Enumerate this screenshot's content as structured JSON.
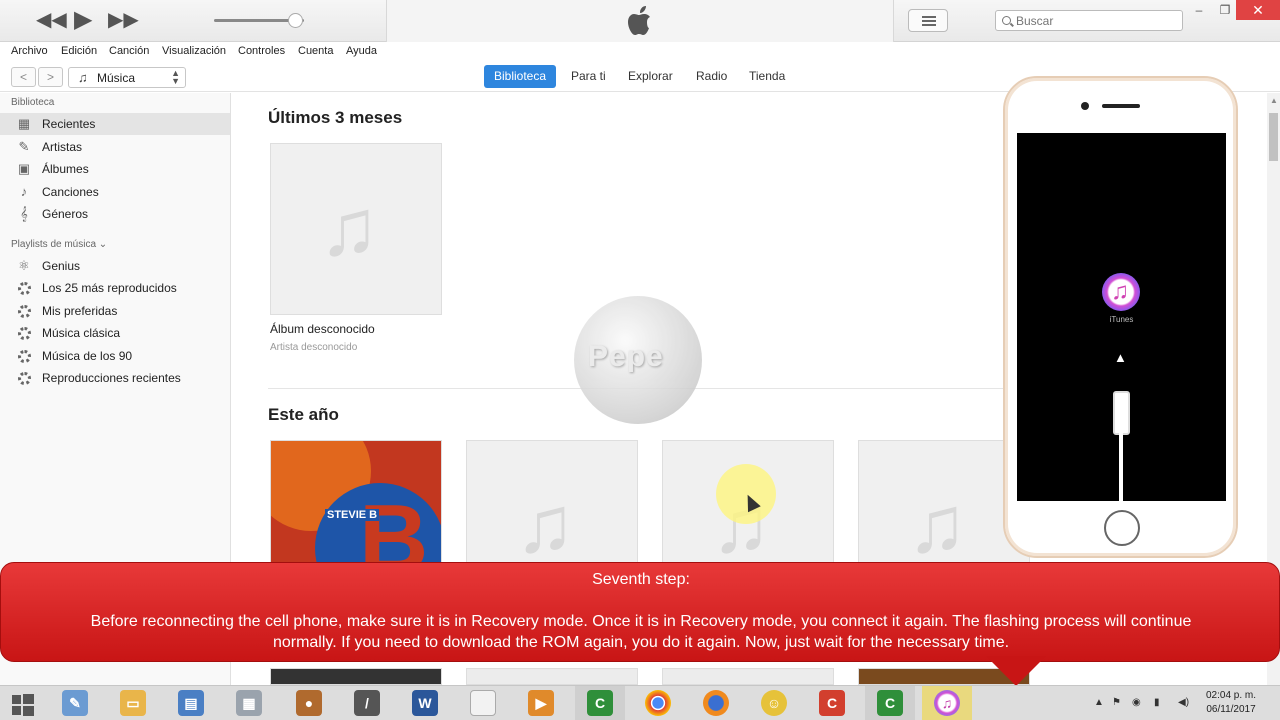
{
  "window": {
    "search_placeholder": "Buscar",
    "minimize": "–",
    "restore": "❐",
    "close": "✕"
  },
  "player": {
    "rewind": "◀◀",
    "play": "▶",
    "forward": "▶▶",
    "volume_level": 0.9
  },
  "menu": [
    "Archivo",
    "Edición",
    "Canción",
    "Visualización",
    "Controles",
    "Cuenta",
    "Ayuda"
  ],
  "nav": {
    "back": "<",
    "forward": ">",
    "media_type": "Música",
    "tabs": [
      "Biblioteca",
      "Para ti",
      "Explorar",
      "Radio",
      "Tienda"
    ],
    "active_tab": "Biblioteca"
  },
  "sidebar": {
    "library_heading": "Biblioteca",
    "library_items": [
      "Recientes",
      "Artistas",
      "Álbumes",
      "Canciones",
      "Géneros"
    ],
    "playlists_heading": "Playlists de música ⌄",
    "playlist_items": [
      "Genius",
      "Los 25 más reproducidos",
      "Mis preferidas",
      "Música clásica",
      "Música de los 90",
      "Reproducciones recientes"
    ]
  },
  "main": {
    "section1_title": "Últimos 3 meses",
    "album_title": "Álbum desconocido",
    "album_artist": "Artista desconocido",
    "section2_title": "Este año",
    "stevie_letter": "B",
    "stevie_name": "STEVIE B"
  },
  "watermark": "Pepe",
  "phone": {
    "itunes_label": "iTunes"
  },
  "caption": {
    "step": "Seventh step:",
    "body": "Before reconnecting the cell phone, make sure it is in Recovery mode. Once it is in Recovery mode, you connect it again. The flashing process will continue normally. If you need to download the ROM again, you do it again. Now, just wait for the necessary time."
  },
  "taskbar": {
    "clock_time": "02:04 p. m.",
    "clock_date": "06/11/2017"
  }
}
